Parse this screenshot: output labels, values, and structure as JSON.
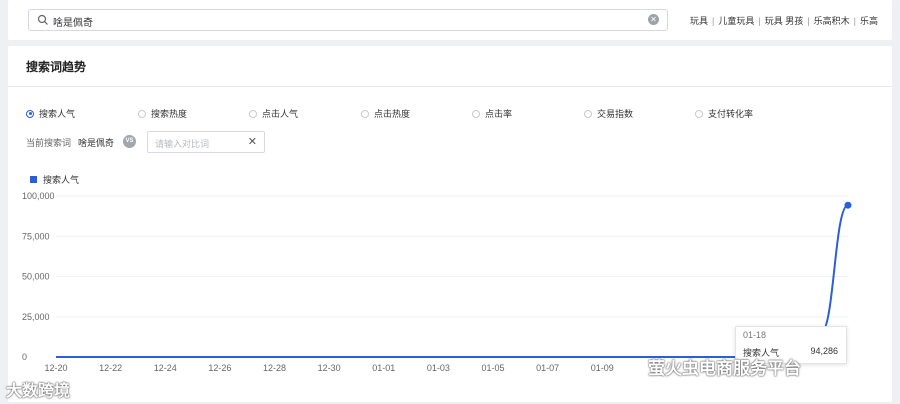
{
  "search": {
    "value": "啥是佩奇",
    "suggestions": [
      "玩具",
      "儿童玩具",
      "玩具 男孩",
      "乐高积木",
      "乐高"
    ]
  },
  "section": {
    "title": "搜索词趋势"
  },
  "metrics": [
    {
      "label": "搜索人气",
      "checked": true
    },
    {
      "label": "搜索热度",
      "checked": false
    },
    {
      "label": "点击人气",
      "checked": false
    },
    {
      "label": "点击热度",
      "checked": false
    },
    {
      "label": "点击率",
      "checked": false
    },
    {
      "label": "交易指数",
      "checked": false
    },
    {
      "label": "支付转化率",
      "checked": false
    }
  ],
  "compare": {
    "current_label": "当前搜索词",
    "current_term": "啥是佩奇",
    "vs_label": "VS",
    "input_placeholder": "请输入对比词",
    "clear_icon": "✕"
  },
  "legend": {
    "label": "搜索人气",
    "color": "#2b5fd9"
  },
  "chart_data": {
    "type": "line",
    "x_ticks": [
      "12-20",
      "12-22",
      "12-24",
      "12-26",
      "12-28",
      "12-30",
      "01-01",
      "01-03",
      "01-05",
      "01-07",
      "01-09"
    ],
    "y_ticks": [
      "100,000",
      "75,000",
      "50,000",
      "25,000",
      "0"
    ],
    "ylim": [
      0,
      100000
    ],
    "series": [
      {
        "name": "搜索人气",
        "color": "#2b5fd9",
        "x": [
          "12-20",
          "12-21",
          "12-22",
          "12-23",
          "12-24",
          "12-25",
          "12-26",
          "12-27",
          "12-28",
          "12-29",
          "12-30",
          "12-31",
          "01-01",
          "01-02",
          "01-03",
          "01-04",
          "01-05",
          "01-06",
          "01-07",
          "01-08",
          "01-09",
          "01-10",
          "01-11",
          "01-12",
          "01-13",
          "01-14",
          "01-15",
          "01-16",
          "01-17",
          "01-18"
        ],
        "values": [
          0,
          0,
          0,
          0,
          0,
          0,
          0,
          0,
          0,
          0,
          0,
          0,
          0,
          0,
          0,
          0,
          0,
          0,
          0,
          0,
          0,
          0,
          0,
          0,
          0,
          0,
          0,
          200,
          15000,
          94286
        ]
      }
    ],
    "grid": true
  },
  "tooltip": {
    "date": "01-18",
    "name": "搜索人气",
    "value": "94,286"
  },
  "watermarks": {
    "left": "大数跨境",
    "right": "萤火虫电商服务平台"
  }
}
